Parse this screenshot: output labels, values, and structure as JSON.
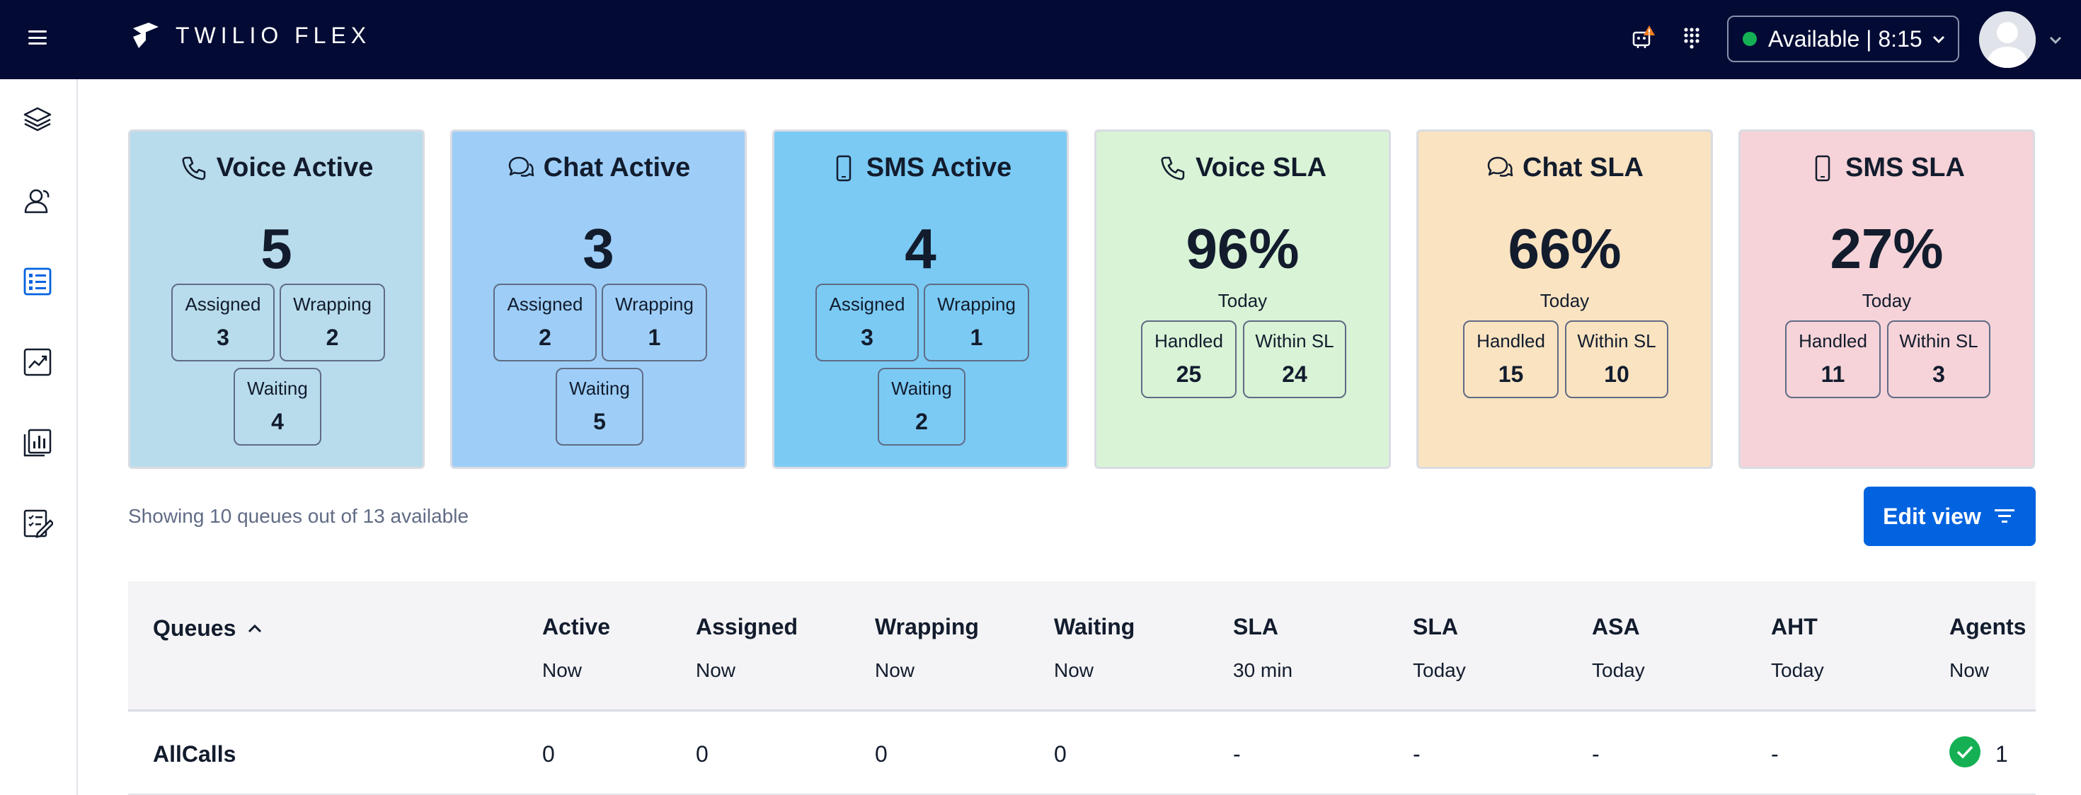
{
  "header": {
    "brand": "TWILIO FLEX",
    "status_label": "Available | 8:15",
    "status_color": "#14b053"
  },
  "sidebar": {
    "items": [
      {
        "icon": "layers-icon"
      },
      {
        "icon": "agents-icon"
      },
      {
        "icon": "queues-stats-icon",
        "active": true
      },
      {
        "icon": "trend-chart-icon"
      },
      {
        "icon": "reports-icon"
      },
      {
        "icon": "edit-list-icon"
      }
    ]
  },
  "cards": [
    {
      "id": "voice-active",
      "title": "Voice Active",
      "icon": "phone-icon",
      "value": "5",
      "sub": "",
      "bg": "#b8dcec",
      "m1_label": "Assigned",
      "m1_value": "3",
      "m2_label": "Wrapping",
      "m2_value": "2",
      "m3_label": "Waiting",
      "m3_value": "4"
    },
    {
      "id": "chat-active",
      "title": "Chat Active",
      "icon": "chat-icon",
      "value": "3",
      "sub": "",
      "bg": "#9ecef7",
      "m1_label": "Assigned",
      "m1_value": "2",
      "m2_label": "Wrapping",
      "m2_value": "1",
      "m3_label": "Waiting",
      "m3_value": "5"
    },
    {
      "id": "sms-active",
      "title": "SMS Active",
      "icon": "mobile-icon",
      "value": "4",
      "sub": "",
      "bg": "#7bcaf4",
      "m1_label": "Assigned",
      "m1_value": "3",
      "m2_label": "Wrapping",
      "m2_value": "1",
      "m3_label": "Waiting",
      "m3_value": "2"
    },
    {
      "id": "voice-sla",
      "title": "Voice SLA",
      "icon": "phone-icon",
      "value": "96%",
      "sub": "Today",
      "bg": "#d9f3d6",
      "m1_label": "Handled",
      "m1_value": "25",
      "m2_label": "Within SL",
      "m2_value": "24"
    },
    {
      "id": "chat-sla",
      "title": "Chat SLA",
      "icon": "chat-icon",
      "value": "66%",
      "sub": "Today",
      "bg": "#fae3c1",
      "m1_label": "Handled",
      "m1_value": "15",
      "m2_label": "Within SL",
      "m2_value": "10"
    },
    {
      "id": "sms-sla",
      "title": "SMS SLA",
      "icon": "mobile-icon",
      "value": "27%",
      "sub": "Today",
      "bg": "#f6d3d8",
      "m1_label": "Handled",
      "m1_value": "11",
      "m2_label": "Within SL",
      "m2_value": "3"
    }
  ],
  "queues_summary": "Showing 10 queues out of 13 available",
  "edit_view_label": "Edit view",
  "table": {
    "queues_label": "Queues",
    "columns": [
      {
        "label": "Active",
        "sub": "Now"
      },
      {
        "label": "Assigned",
        "sub": "Now"
      },
      {
        "label": "Wrapping",
        "sub": "Now"
      },
      {
        "label": "Waiting",
        "sub": "Now"
      },
      {
        "label": "SLA",
        "sub": "30 min"
      },
      {
        "label": "SLA",
        "sub": "Today"
      },
      {
        "label": "ASA",
        "sub": "Today"
      },
      {
        "label": "AHT",
        "sub": "Today"
      },
      {
        "label": "Agents",
        "sub": "Now"
      }
    ],
    "rows": [
      {
        "name": "AllCalls",
        "cells": [
          "0",
          "0",
          "0",
          "0",
          "-",
          "-",
          "-",
          "-"
        ],
        "agents": "1"
      }
    ]
  }
}
